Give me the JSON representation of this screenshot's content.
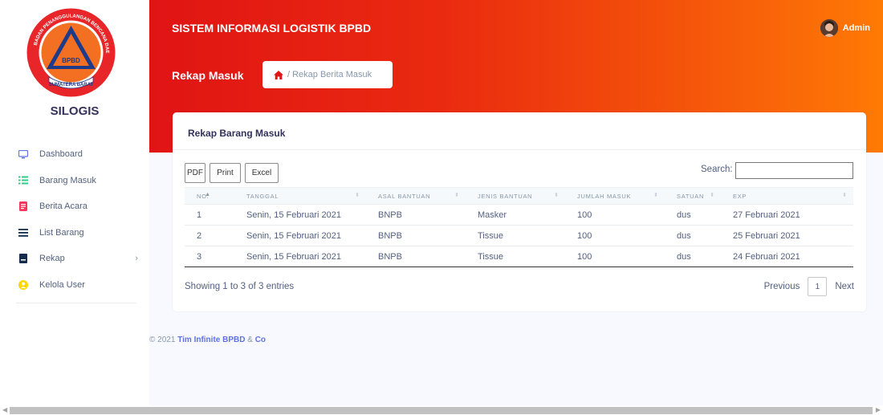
{
  "app": {
    "title": "SISTEM INFORMASI LOGISTIK BPBD",
    "brand": "SILOGIS",
    "logo_text": "BADAN PENANGGULANGAN BENCANA DAERAH BPBD SUMATERA BARAT"
  },
  "user": {
    "name": "Admin"
  },
  "sidebar": {
    "items": [
      {
        "label": "Dashboard",
        "icon": "monitor-icon",
        "color": "#5e72e4"
      },
      {
        "label": "Barang Masuk",
        "icon": "list-icon",
        "color": "#2dce89"
      },
      {
        "label": "Berita Acara",
        "icon": "document-icon",
        "color": "#f5365c"
      },
      {
        "label": "List Barang",
        "icon": "menu-icon",
        "color": "#172b4d"
      },
      {
        "label": "Rekap",
        "icon": "archive-icon",
        "color": "#172b4d",
        "has_submenu": true
      },
      {
        "label": "Kelola User",
        "icon": "user-icon",
        "color": "#ffd600"
      }
    ]
  },
  "header": {
    "page_title": "Rekap Masuk",
    "breadcrumb": "/ Rekap Berita Masuk"
  },
  "card": {
    "title": "Rekap Barang Masuk",
    "buttons": [
      "PDF",
      "Print",
      "Excel"
    ],
    "search_label": "Search:",
    "search_value": "",
    "columns": [
      "NO.",
      "TANGGAL",
      "ASAL BANTUAN",
      "JENIS BANTUAN",
      "JUMLAH MASUK",
      "SATUAN",
      "EXP"
    ],
    "rows": [
      [
        "1",
        "Senin, 15 Februari 2021",
        "BNPB",
        "Masker",
        "100",
        "dus",
        "27 Februari 2021"
      ],
      [
        "2",
        "Senin, 15 Februari 2021",
        "BNPB",
        "Tissue",
        "100",
        "dus",
        "25 Februari 2021"
      ],
      [
        "3",
        "Senin, 15 Februari 2021",
        "BNPB",
        "Tissue",
        "100",
        "dus",
        "24 Februari 2021"
      ]
    ],
    "info": "Showing 1 to 3 of 3 entries",
    "pagination": {
      "previous": "Previous",
      "current": "1",
      "next": "Next"
    }
  },
  "footer": {
    "copyright": "© 2021",
    "link": "Tim Infinite BPBD",
    "amp": "&",
    "co": "Co"
  },
  "colors": {
    "header_start": "#e01414",
    "header_end": "#ff7a05",
    "link": "#5e72e4"
  }
}
